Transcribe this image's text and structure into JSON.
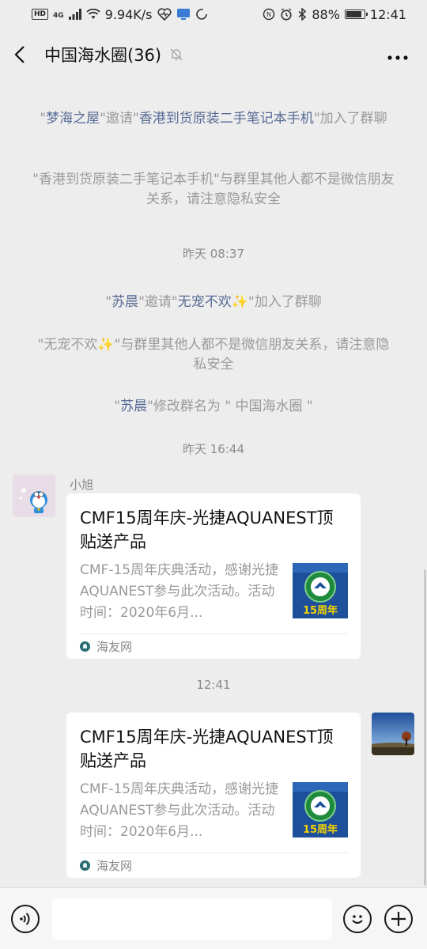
{
  "status_bar": {
    "hd": "HD",
    "network": "4G",
    "speed": "9.94K/s",
    "battery": "88%",
    "battery_level": 0.88,
    "time": "12:41"
  },
  "header": {
    "title": "中国海水圈(36)"
  },
  "messages": {
    "sys1": {
      "q1": "\"",
      "name1": "梦海之屋",
      "q2": "\"邀请\"",
      "name2": "香港到货原装二手笔记本手机",
      "q3": "\"加入了群聊"
    },
    "sys2": {
      "text": "\"香港到货原装二手笔记本手机\"与群里其他人都不是微信朋友关系，请注意隐私安全"
    },
    "time1": "昨天 08:37",
    "sys3": {
      "q1": "\"",
      "name1": "苏晨",
      "q2": "\"邀请\"",
      "name2": "无宠不欢✨",
      "q3": "\"加入了群聊"
    },
    "sys4": {
      "text": "\"无宠不欢✨\"与群里其他人都不是微信朋友关系，请注意隐私安全"
    },
    "sys5": {
      "q1": "\"",
      "name1": "苏晨",
      "q2": "\"修改群名为 \" 中国海水圈 \""
    },
    "time2": "昨天 16:44",
    "msg1": {
      "sender": "小旭",
      "title": "CMF15周年庆-光捷AQUANEST顶贴送产品",
      "desc": "CMF-15周年庆典活动，感谢光捷AQUANEST参与此次活动。活动时间：2020年6月...",
      "thumb_text": "15周年",
      "source": "海友网"
    },
    "time3": "12:41",
    "msg2": {
      "title": "CMF15周年庆-光捷AQUANEST顶贴送产品",
      "desc": "CMF-15周年庆典活动，感谢光捷AQUANEST参与此次活动。活动时间：2020年6月...",
      "thumb_text": "15周年",
      "source": "海友网"
    }
  },
  "input": {
    "placeholder": ""
  },
  "colors": {
    "link": "#576b95",
    "background": "#ededed",
    "system_text": "#9a9a9a"
  },
  "icons": [
    "back-icon",
    "mute-icon",
    "more-icon",
    "voice-icon",
    "emoji-icon",
    "plus-icon"
  ]
}
